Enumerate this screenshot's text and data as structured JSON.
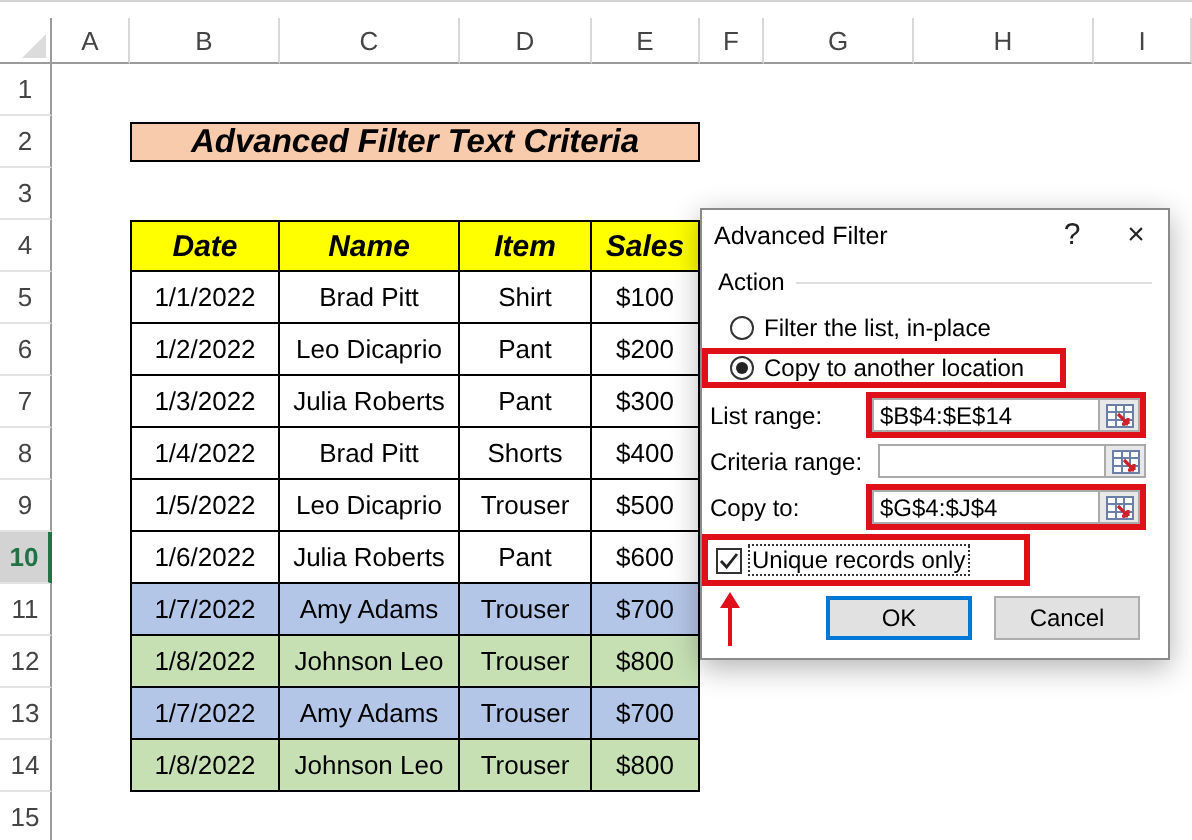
{
  "sheet": {
    "columns": [
      "A",
      "B",
      "C",
      "D",
      "E",
      "F",
      "G",
      "H",
      "I"
    ],
    "rows": [
      {
        "label": "1",
        "selected": false
      },
      {
        "label": "2",
        "selected": false
      },
      {
        "label": "3",
        "selected": false
      },
      {
        "label": "4",
        "selected": false
      },
      {
        "label": "5",
        "selected": false
      },
      {
        "label": "6",
        "selected": false
      },
      {
        "label": "7",
        "selected": false
      },
      {
        "label": "8",
        "selected": false
      },
      {
        "label": "9",
        "selected": false
      },
      {
        "label": "10",
        "selected": true
      },
      {
        "label": "11",
        "selected": false
      },
      {
        "label": "12",
        "selected": false
      },
      {
        "label": "13",
        "selected": false
      },
      {
        "label": "14",
        "selected": false
      },
      {
        "label": "15",
        "selected": false
      }
    ]
  },
  "title": "Advanced Filter Text Criteria",
  "table": {
    "columns": [
      "Date",
      "Name",
      "Item",
      "Sales"
    ],
    "rows": [
      {
        "cells": [
          "1/1/2022",
          "Brad Pitt",
          "Shirt",
          "$100"
        ],
        "color": "#ffffff"
      },
      {
        "cells": [
          "1/2/2022",
          "Leo Dicaprio",
          "Pant",
          "$200"
        ],
        "color": "#ffffff"
      },
      {
        "cells": [
          "1/3/2022",
          "Julia Roberts",
          "Pant",
          "$300"
        ],
        "color": "#ffffff"
      },
      {
        "cells": [
          "1/4/2022",
          "Brad Pitt",
          "Shorts",
          "$400"
        ],
        "color": "#ffffff"
      },
      {
        "cells": [
          "1/5/2022",
          "Leo Dicaprio",
          "Trouser",
          "$500"
        ],
        "color": "#ffffff"
      },
      {
        "cells": [
          "1/6/2022",
          "Julia Roberts",
          "Pant",
          "$600"
        ],
        "color": "#ffffff"
      },
      {
        "cells": [
          "1/7/2022",
          "Amy Adams",
          "Trouser",
          "$700"
        ],
        "color": "#b4c6e7"
      },
      {
        "cells": [
          "1/8/2022",
          "Johnson Leo",
          "Trouser",
          "$800"
        ],
        "color": "#c6e0b4"
      },
      {
        "cells": [
          "1/7/2022",
          "Amy Adams",
          "Trouser",
          "$700"
        ],
        "color": "#b4c6e7"
      },
      {
        "cells": [
          "1/8/2022",
          "Johnson Leo",
          "Trouser",
          "$800"
        ],
        "color": "#c6e0b4"
      }
    ]
  },
  "dialog": {
    "title": "Advanced Filter",
    "help": "?",
    "close": "×",
    "group_label": "Action",
    "options": [
      {
        "label": "Filter the list, in-place",
        "selected": false,
        "highlighted": false
      },
      {
        "label": "Copy to another location",
        "selected": true,
        "highlighted": true
      }
    ],
    "fields": [
      {
        "label": "List range:",
        "value": "$B$4:$E$14",
        "highlighted": true
      },
      {
        "label": "Criteria range:",
        "highlighted": false
      },
      {
        "label": "Copy to:",
        "value": "$G$4:$J$4",
        "highlighted": true
      }
    ],
    "checkbox": {
      "label": "Unique records only",
      "checked": true,
      "highlighted": true
    },
    "pointer_arrow": true,
    "buttons": [
      {
        "label": "OK",
        "default": true
      },
      {
        "label": "Cancel",
        "default": false
      }
    ]
  }
}
